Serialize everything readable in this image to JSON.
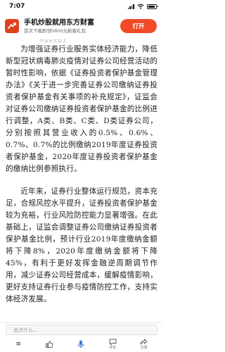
{
  "status_bar": {
    "time": "7:07"
  },
  "ad_banner": {
    "title": "手机炒股就用东方财富",
    "subtitle": "首次下载即领5800元新客礼包",
    "button_label": "打开",
    "brand_color": "#e0411f",
    "button_color": "#f04a26"
  },
  "partial_line": "为加快大会上",
  "article": {
    "paragraphs": [
      "为增强证券行业服务实体经济能力，降低新型冠状病毒肺炎疫情对证券公司经营活动的暂时性影响，依据《证券投资者保护基金管理办法》《关于进一步完善证券公司缴纳证券投资者保护基金有关事项的补充规定》，证监会对证券公司缴纳证券投资者保护基金的比例进行调整，A类、B类、C类、D类证券公司，分别按照其营业收入的0.5%、0.6%、0.7%、0.7%的比例缴纳2019年度证券投资者保护基金，2020年度证券投资者保护基金的缴纳比例参照执行。",
      "近年来，证券行业整体运行规范，资本充足，合规风控水平提升，证券投资者保护基金较为充裕，行业风险防控能力显著增强。在此基础上，证监会调整证券公司缴纳证券投资者保护基金比例，预计行业2019年度缴纳金额将下降8%，2020年度缴纳金额将下降45%，有利于更好发挥金融逆周期调节作用，减少证券公司经营成本，缓解疫情影响，更好支持证券行业参与疫情防控工作，支持实体经济发展。"
    ]
  },
  "bottom_bar": {
    "comment_placeholder": "说点什么...",
    "tools": [
      {
        "name": "menu",
        "label": "≡"
      },
      {
        "name": "like",
        "label": ""
      },
      {
        "name": "mic",
        "label": ""
      },
      {
        "name": "comment",
        "label": "评论"
      },
      {
        "name": "share",
        "label": "分享"
      }
    ],
    "accent_color": "#3b7bd8"
  }
}
